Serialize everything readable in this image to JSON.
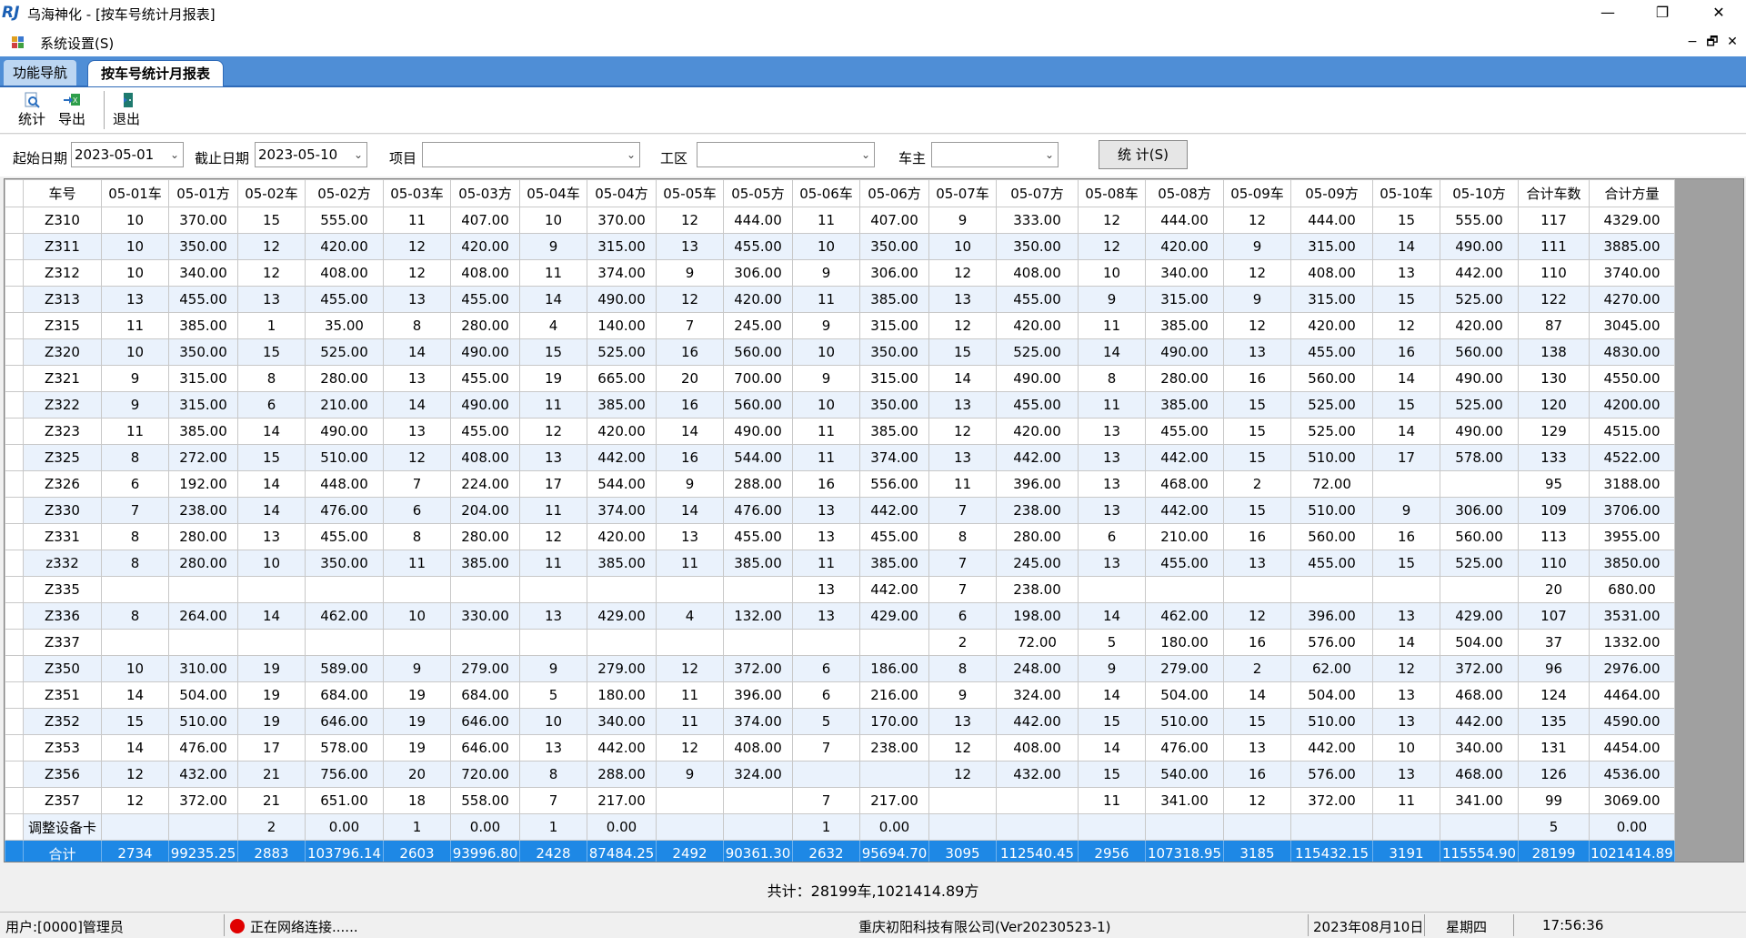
{
  "window": {
    "title": "乌海神化 - [按车号统计月报表]",
    "logo": "RJ",
    "minimize": "—",
    "maximize": "❐",
    "close": "✕"
  },
  "menu": {
    "system_settings": "系统设置(S)",
    "mdi_min": "−",
    "mdi_restore": "🗗",
    "mdi_close": "✕"
  },
  "tabs": [
    {
      "label": "功能导航"
    },
    {
      "label": "按车号统计月报表"
    }
  ],
  "toolbar": {
    "stat": "统计",
    "export": "导出",
    "exit": "退出"
  },
  "filters": {
    "start_label": "起始日期",
    "start_value": "2023-05-01",
    "end_label": "截止日期",
    "end_value": "2023-05-10",
    "project_label": "项目",
    "project_value": "",
    "workarea_label": "工区",
    "workarea_value": "",
    "owner_label": "车主",
    "owner_value": "",
    "stat_button": "统 计(S)"
  },
  "table": {
    "headers": [
      "车号",
      "05-01车",
      "05-01方",
      "05-02车",
      "05-02方",
      "05-03车",
      "05-03方",
      "05-04车",
      "05-04方",
      "05-05车",
      "05-05方",
      "05-06车",
      "05-06方",
      "05-07车",
      "05-07方",
      "05-08车",
      "05-08方",
      "05-09车",
      "05-09方",
      "05-10车",
      "05-10方",
      "合计车数",
      "合计方量"
    ],
    "rows": [
      [
        "Z310",
        "10",
        "370.00",
        "15",
        "555.00",
        "11",
        "407.00",
        "10",
        "370.00",
        "12",
        "444.00",
        "11",
        "407.00",
        "9",
        "333.00",
        "12",
        "444.00",
        "12",
        "444.00",
        "15",
        "555.00",
        "117",
        "4329.00"
      ],
      [
        "Z311",
        "10",
        "350.00",
        "12",
        "420.00",
        "12",
        "420.00",
        "9",
        "315.00",
        "13",
        "455.00",
        "10",
        "350.00",
        "10",
        "350.00",
        "12",
        "420.00",
        "9",
        "315.00",
        "14",
        "490.00",
        "111",
        "3885.00"
      ],
      [
        "Z312",
        "10",
        "340.00",
        "12",
        "408.00",
        "12",
        "408.00",
        "11",
        "374.00",
        "9",
        "306.00",
        "9",
        "306.00",
        "12",
        "408.00",
        "10",
        "340.00",
        "12",
        "408.00",
        "13",
        "442.00",
        "110",
        "3740.00"
      ],
      [
        "Z313",
        "13",
        "455.00",
        "13",
        "455.00",
        "13",
        "455.00",
        "14",
        "490.00",
        "12",
        "420.00",
        "11",
        "385.00",
        "13",
        "455.00",
        "9",
        "315.00",
        "9",
        "315.00",
        "15",
        "525.00",
        "122",
        "4270.00"
      ],
      [
        "Z315",
        "11",
        "385.00",
        "1",
        "35.00",
        "8",
        "280.00",
        "4",
        "140.00",
        "7",
        "245.00",
        "9",
        "315.00",
        "12",
        "420.00",
        "11",
        "385.00",
        "12",
        "420.00",
        "12",
        "420.00",
        "87",
        "3045.00"
      ],
      [
        "Z320",
        "10",
        "350.00",
        "15",
        "525.00",
        "14",
        "490.00",
        "15",
        "525.00",
        "16",
        "560.00",
        "10",
        "350.00",
        "15",
        "525.00",
        "14",
        "490.00",
        "13",
        "455.00",
        "16",
        "560.00",
        "138",
        "4830.00"
      ],
      [
        "Z321",
        "9",
        "315.00",
        "8",
        "280.00",
        "13",
        "455.00",
        "19",
        "665.00",
        "20",
        "700.00",
        "9",
        "315.00",
        "14",
        "490.00",
        "8",
        "280.00",
        "16",
        "560.00",
        "14",
        "490.00",
        "130",
        "4550.00"
      ],
      [
        "Z322",
        "9",
        "315.00",
        "6",
        "210.00",
        "14",
        "490.00",
        "11",
        "385.00",
        "16",
        "560.00",
        "10",
        "350.00",
        "13",
        "455.00",
        "11",
        "385.00",
        "15",
        "525.00",
        "15",
        "525.00",
        "120",
        "4200.00"
      ],
      [
        "Z323",
        "11",
        "385.00",
        "14",
        "490.00",
        "13",
        "455.00",
        "12",
        "420.00",
        "14",
        "490.00",
        "11",
        "385.00",
        "12",
        "420.00",
        "13",
        "455.00",
        "15",
        "525.00",
        "14",
        "490.00",
        "129",
        "4515.00"
      ],
      [
        "Z325",
        "8",
        "272.00",
        "15",
        "510.00",
        "12",
        "408.00",
        "13",
        "442.00",
        "16",
        "544.00",
        "11",
        "374.00",
        "13",
        "442.00",
        "13",
        "442.00",
        "15",
        "510.00",
        "17",
        "578.00",
        "133",
        "4522.00"
      ],
      [
        "Z326",
        "6",
        "192.00",
        "14",
        "448.00",
        "7",
        "224.00",
        "17",
        "544.00",
        "9",
        "288.00",
        "16",
        "556.00",
        "11",
        "396.00",
        "13",
        "468.00",
        "2",
        "72.00",
        "",
        "",
        "95",
        "3188.00"
      ],
      [
        "Z330",
        "7",
        "238.00",
        "14",
        "476.00",
        "6",
        "204.00",
        "11",
        "374.00",
        "14",
        "476.00",
        "13",
        "442.00",
        "7",
        "238.00",
        "13",
        "442.00",
        "15",
        "510.00",
        "9",
        "306.00",
        "109",
        "3706.00"
      ],
      [
        "Z331",
        "8",
        "280.00",
        "13",
        "455.00",
        "8",
        "280.00",
        "12",
        "420.00",
        "13",
        "455.00",
        "13",
        "455.00",
        "8",
        "280.00",
        "6",
        "210.00",
        "16",
        "560.00",
        "16",
        "560.00",
        "113",
        "3955.00"
      ],
      [
        "z332",
        "8",
        "280.00",
        "10",
        "350.00",
        "11",
        "385.00",
        "11",
        "385.00",
        "11",
        "385.00",
        "11",
        "385.00",
        "7",
        "245.00",
        "13",
        "455.00",
        "13",
        "455.00",
        "15",
        "525.00",
        "110",
        "3850.00"
      ],
      [
        "Z335",
        "",
        "",
        "",
        "",
        "",
        "",
        "",
        "",
        "",
        "",
        "13",
        "442.00",
        "7",
        "238.00",
        "",
        "",
        "",
        "",
        "",
        "",
        "20",
        "680.00"
      ],
      [
        "Z336",
        "8",
        "264.00",
        "14",
        "462.00",
        "10",
        "330.00",
        "13",
        "429.00",
        "4",
        "132.00",
        "13",
        "429.00",
        "6",
        "198.00",
        "14",
        "462.00",
        "12",
        "396.00",
        "13",
        "429.00",
        "107",
        "3531.00"
      ],
      [
        "Z337",
        "",
        "",
        "",
        "",
        "",
        "",
        "",
        "",
        "",
        "",
        "",
        "",
        "2",
        "72.00",
        "5",
        "180.00",
        "16",
        "576.00",
        "14",
        "504.00",
        "37",
        "1332.00"
      ],
      [
        "Z350",
        "10",
        "310.00",
        "19",
        "589.00",
        "9",
        "279.00",
        "9",
        "279.00",
        "12",
        "372.00",
        "6",
        "186.00",
        "8",
        "248.00",
        "9",
        "279.00",
        "2",
        "62.00",
        "12",
        "372.00",
        "96",
        "2976.00"
      ],
      [
        "Z351",
        "14",
        "504.00",
        "19",
        "684.00",
        "19",
        "684.00",
        "5",
        "180.00",
        "11",
        "396.00",
        "6",
        "216.00",
        "9",
        "324.00",
        "14",
        "504.00",
        "14",
        "504.00",
        "13",
        "468.00",
        "124",
        "4464.00"
      ],
      [
        "Z352",
        "15",
        "510.00",
        "19",
        "646.00",
        "19",
        "646.00",
        "10",
        "340.00",
        "11",
        "374.00",
        "5",
        "170.00",
        "13",
        "442.00",
        "15",
        "510.00",
        "15",
        "510.00",
        "13",
        "442.00",
        "135",
        "4590.00"
      ],
      [
        "Z353",
        "14",
        "476.00",
        "17",
        "578.00",
        "19",
        "646.00",
        "13",
        "442.00",
        "12",
        "408.00",
        "7",
        "238.00",
        "12",
        "408.00",
        "14",
        "476.00",
        "13",
        "442.00",
        "10",
        "340.00",
        "131",
        "4454.00"
      ],
      [
        "Z356",
        "12",
        "432.00",
        "21",
        "756.00",
        "20",
        "720.00",
        "8",
        "288.00",
        "9",
        "324.00",
        "",
        "",
        "12",
        "432.00",
        "15",
        "540.00",
        "16",
        "576.00",
        "13",
        "468.00",
        "126",
        "4536.00"
      ],
      [
        "Z357",
        "12",
        "372.00",
        "21",
        "651.00",
        "18",
        "558.00",
        "7",
        "217.00",
        "",
        "",
        "7",
        "217.00",
        "",
        "",
        "11",
        "341.00",
        "12",
        "372.00",
        "11",
        "341.00",
        "99",
        "3069.00"
      ],
      [
        "调整设备卡",
        "",
        "",
        "2",
        "0.00",
        "1",
        "0.00",
        "1",
        "0.00",
        "",
        "",
        "1",
        "0.00",
        "",
        "",
        "",
        "",
        "",
        "",
        "",
        "",
        "5",
        "0.00"
      ]
    ],
    "total": [
      "合计",
      "2734",
      "99235.25",
      "2883",
      "103796.14",
      "2603",
      "93996.80",
      "2428",
      "87484.25",
      "2492",
      "90361.30",
      "2632",
      "95694.70",
      "3095",
      "112540.45",
      "2956",
      "107318.95",
      "3185",
      "115432.15",
      "3191",
      "115554.90",
      "28199",
      "1021414.89"
    ]
  },
  "summary": "共计：28199车,1021414.89方",
  "status": {
    "user": "用户:[0000]管理员",
    "network": "正在网络连接......",
    "company": "重庆初阳科技有限公司(Ver20230523-1)",
    "date": "2023年08月10日",
    "weekday": "星期四",
    "time": "17:56:36"
  }
}
